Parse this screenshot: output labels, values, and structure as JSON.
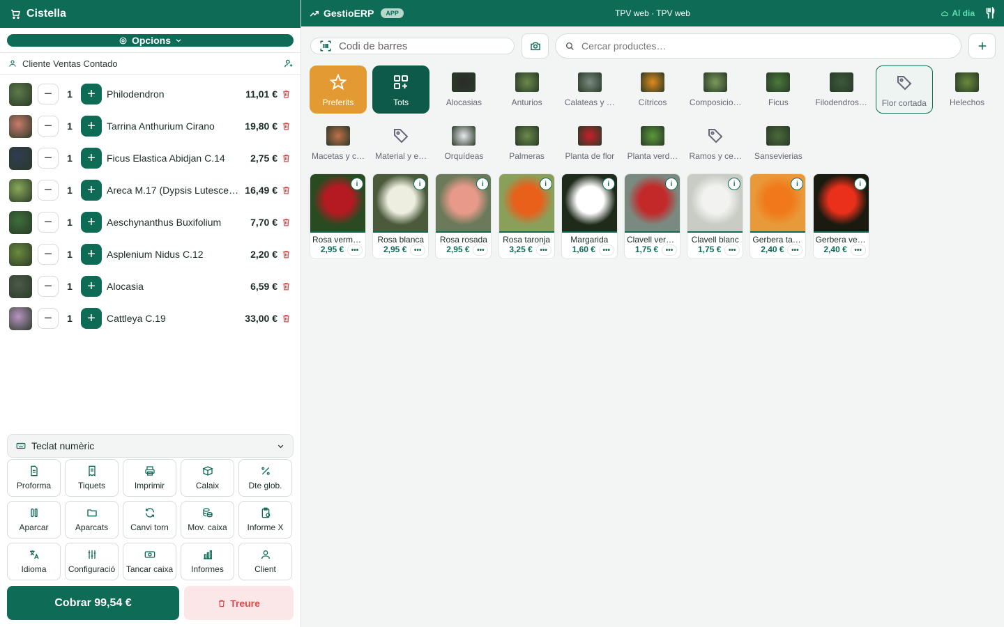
{
  "cart": {
    "title": "Cistella",
    "options_label": "Opcions",
    "client_name": "Cliente Ventas Contado",
    "items": [
      {
        "name": "Philodendron",
        "qty": "1",
        "price": "11,01 €",
        "color": "#5d7a4a"
      },
      {
        "name": "Tarrina Anthurium Cirano",
        "qty": "1",
        "price": "19,80 €",
        "color": "#c97a6b"
      },
      {
        "name": "Ficus Elastica Abidjan C.14",
        "qty": "1",
        "price": "2,75 €",
        "color": "#2f3c52"
      },
      {
        "name": "Areca M.17 (Dypsis Lutesce…",
        "qty": "1",
        "price": "16,49 €",
        "color": "#8aa95a"
      },
      {
        "name": "Aeschynanthus Buxifolium",
        "qty": "1",
        "price": "7,70 €",
        "color": "#3d6e3a"
      },
      {
        "name": "Asplenium Nidus C.12",
        "qty": "1",
        "price": "2,20 €",
        "color": "#6b8a3e"
      },
      {
        "name": "Alocasia",
        "qty": "1",
        "price": "6,59 €",
        "color": "#4c5a4a"
      },
      {
        "name": "Cattleya C.19",
        "qty": "1",
        "price": "33,00 €",
        "color": "#b894c2"
      }
    ],
    "keypad_label": "Teclat numèric",
    "actions": [
      {
        "label": "Proforma",
        "icon": "document-icon"
      },
      {
        "label": "Tiquets",
        "icon": "receipt-icon"
      },
      {
        "label": "Imprimir",
        "icon": "printer-icon"
      },
      {
        "label": "Calaix",
        "icon": "box-icon"
      },
      {
        "label": "Dte glob.",
        "icon": "percent-icon"
      },
      {
        "label": "Aparcar",
        "icon": "pause-icon"
      },
      {
        "label": "Aparcats",
        "icon": "folder-icon"
      },
      {
        "label": "Canvi torn",
        "icon": "refresh-icon"
      },
      {
        "label": "Mov. caixa",
        "icon": "coins-icon"
      },
      {
        "label": "Informe X",
        "icon": "clipboard-icon"
      },
      {
        "label": "Idioma",
        "icon": "language-icon"
      },
      {
        "label": "Configuració",
        "icon": "sliders-icon"
      },
      {
        "label": "Tancar caixa",
        "icon": "cash-icon"
      },
      {
        "label": "Informes",
        "icon": "bar-chart-icon"
      },
      {
        "label": "Client",
        "icon": "user-icon"
      }
    ],
    "pay_label": "Cobrar 99,54 €",
    "clear_label": "Treure"
  },
  "topbar": {
    "brand": "GestioERP",
    "badge": "APP",
    "title": "TPV web · TPV web",
    "sync": "Al dia"
  },
  "toolbar": {
    "barcode_placeholder": "Codi de barres",
    "search_placeholder": "Cercar productes…"
  },
  "categories": [
    {
      "label": "Preferits",
      "kind": "fav"
    },
    {
      "label": "Tots",
      "kind": "all"
    },
    {
      "label": "Alocasias",
      "kind": "img",
      "color": "#2b2b2b"
    },
    {
      "label": "Anturios",
      "kind": "img",
      "color": "#6b8a4a"
    },
    {
      "label": "Calateas y …",
      "kind": "img",
      "color": "#7a8a80"
    },
    {
      "label": "Cítricos",
      "kind": "img",
      "color": "#e08a1a"
    },
    {
      "label": "Composicio…",
      "kind": "img",
      "color": "#7a9a5a"
    },
    {
      "label": "Ficus",
      "kind": "img",
      "color": "#4a7a3a"
    },
    {
      "label": "Filodendros…",
      "kind": "img",
      "color": "#3a5a3a"
    },
    {
      "label": "Flor cortada",
      "kind": "tag",
      "selected": true
    },
    {
      "label": "Helechos",
      "kind": "img",
      "color": "#6a8a3a"
    },
    {
      "label": "Macetas y c…",
      "kind": "img",
      "color": "#c0704a"
    },
    {
      "label": "Material y e…",
      "kind": "tag"
    },
    {
      "label": "Orquídeas",
      "kind": "img",
      "color": "#e8e8ee"
    },
    {
      "label": "Palmeras",
      "kind": "img",
      "color": "#6a8a4a"
    },
    {
      "label": "Planta de flor",
      "kind": "img",
      "color": "#c8202a"
    },
    {
      "label": "Planta verd…",
      "kind": "img",
      "color": "#5a9a3a"
    },
    {
      "label": "Ramos y ce…",
      "kind": "tag"
    },
    {
      "label": "Sansevierias",
      "kind": "img",
      "color": "#4a6a3a"
    }
  ],
  "products": [
    {
      "name": "Rosa vermella",
      "price": "2,95 €",
      "color": "#b51a22",
      "bg": "#2a4a22"
    },
    {
      "name": "Rosa blanca",
      "price": "2,95 €",
      "color": "#eeeee0",
      "bg": "#4a5a3a"
    },
    {
      "name": "Rosa rosada",
      "price": "2,95 €",
      "color": "#e89a8a",
      "bg": "#6a7a5a"
    },
    {
      "name": "Rosa taronja",
      "price": "3,25 €",
      "color": "#e8601a",
      "bg": "#8aa05a"
    },
    {
      "name": "Margarida",
      "price": "1,60 €",
      "color": "#ffffff",
      "bg": "#1e2a1a"
    },
    {
      "name": "Clavell verm…",
      "price": "1,75 €",
      "color": "#c22a2a",
      "bg": "#7a8a80"
    },
    {
      "name": "Clavell blanc",
      "price": "1,75 €",
      "color": "#f2f2f0",
      "bg": "#c8ccc4"
    },
    {
      "name": "Gerbera tar…",
      "price": "2,40 €",
      "color": "#f07a1a",
      "bg": "#e89a3a"
    },
    {
      "name": "Gerbera ver…",
      "price": "2,40 €",
      "color": "#e8301a",
      "bg": "#1a1a10"
    }
  ]
}
